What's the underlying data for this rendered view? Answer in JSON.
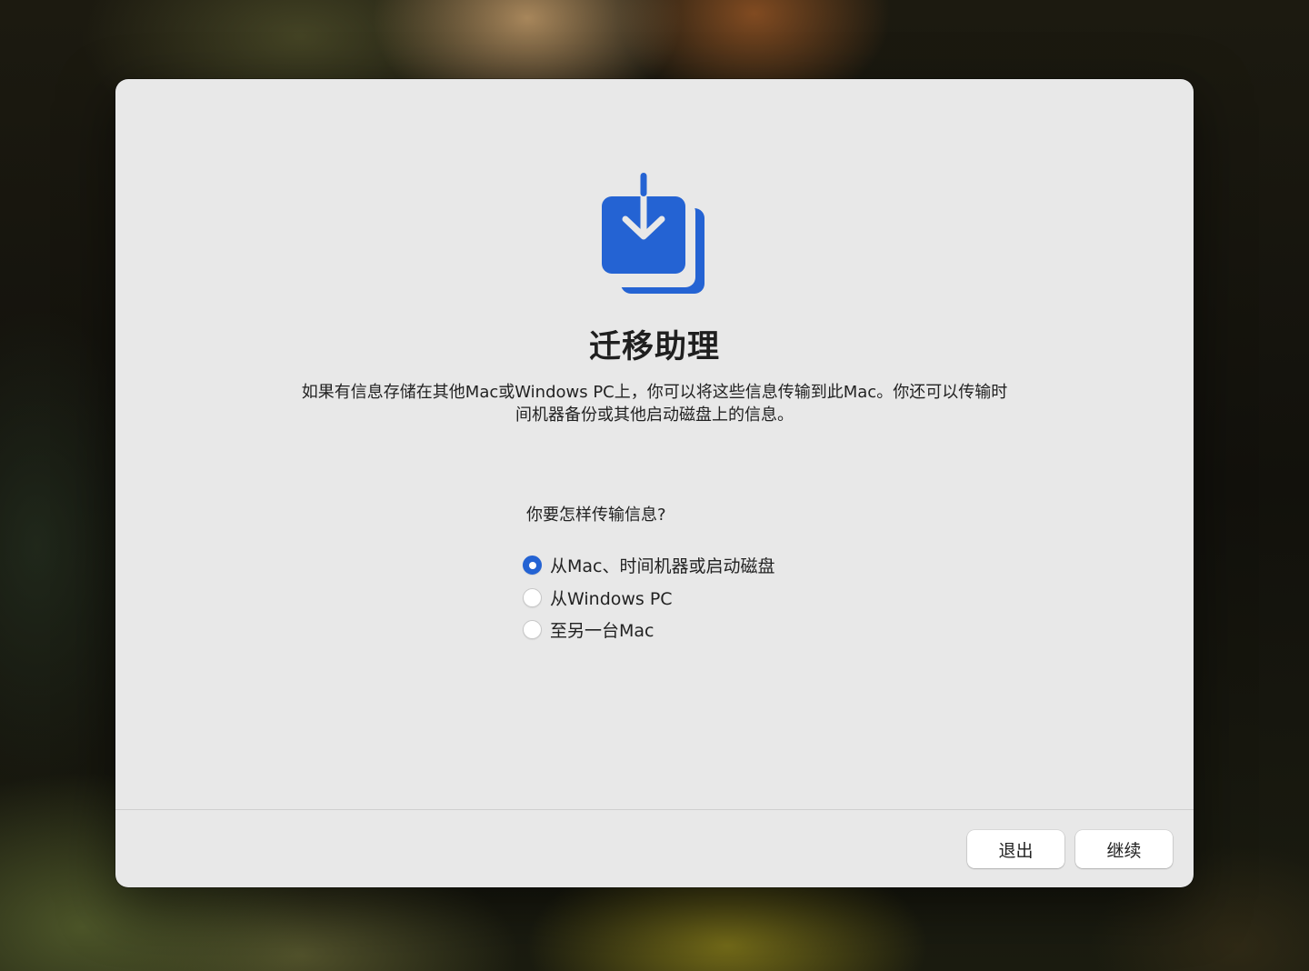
{
  "window": {
    "icon": "migration-assistant-icon",
    "title": "迁移助理",
    "description_line1": "如果有信息存储在其他Mac或Windows PC上，你可以将这些信息传输到此Mac。你还可以传输时",
    "description_line2": "间机器备份或其他启动磁盘上的信息。",
    "question": "你要怎样传输信息?"
  },
  "options": [
    {
      "label": "从Mac、时间机器或启动磁盘",
      "selected": true
    },
    {
      "label": "从Windows PC",
      "selected": false
    },
    {
      "label": "至另一台Mac",
      "selected": false
    }
  ],
  "buttons": {
    "quit": "退出",
    "continue": "继续"
  },
  "colors": {
    "accent": "#2463d3",
    "window_background": "#e8e8e8"
  }
}
